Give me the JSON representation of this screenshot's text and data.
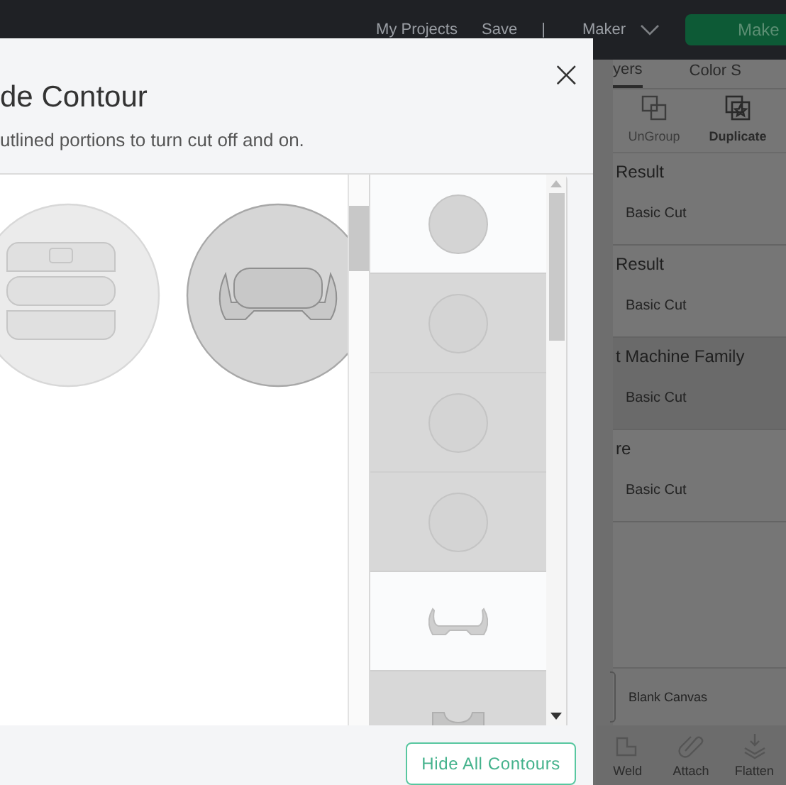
{
  "top_bar": {
    "links": [
      "My Projects",
      "Save"
    ],
    "separator": "|",
    "machine": "Maker",
    "make_button": "Make"
  },
  "panel": {
    "tabs": [
      {
        "label": "yers",
        "selected": true
      },
      {
        "label": "Color S",
        "selected": false
      }
    ],
    "tools": [
      {
        "label": "UnGroup",
        "disabled": true
      },
      {
        "label": "Duplicate",
        "disabled": false
      }
    ],
    "layers": [
      {
        "title": "Result",
        "operation": "Basic Cut",
        "selected": false
      },
      {
        "title": "Result",
        "operation": "Basic Cut",
        "selected": false
      },
      {
        "title": "t Machine Family",
        "operation": "Basic Cut",
        "selected": true
      },
      {
        "title": "re",
        "operation": "Basic Cut",
        "selected": false
      }
    ],
    "canvas_row": "Blank Canvas",
    "bottom_tools": [
      "Weld",
      "Attach",
      "Flatten"
    ]
  },
  "dialog": {
    "title": "de Contour",
    "subtitle": "utlined portions to turn cut off and on.",
    "close": "×",
    "canvas_parts": [
      {
        "kind": "stack",
        "on": false
      },
      {
        "kind": "bracket",
        "on": true
      }
    ],
    "thumbnails": [
      {
        "kind": "circle",
        "selected": false
      },
      {
        "kind": "circle",
        "selected": true
      },
      {
        "kind": "circle",
        "selected": true
      },
      {
        "kind": "circle",
        "selected": true
      },
      {
        "kind": "bracket",
        "selected": false
      },
      {
        "kind": "notch",
        "selected": true
      }
    ],
    "button": "Hide All Contours"
  }
}
